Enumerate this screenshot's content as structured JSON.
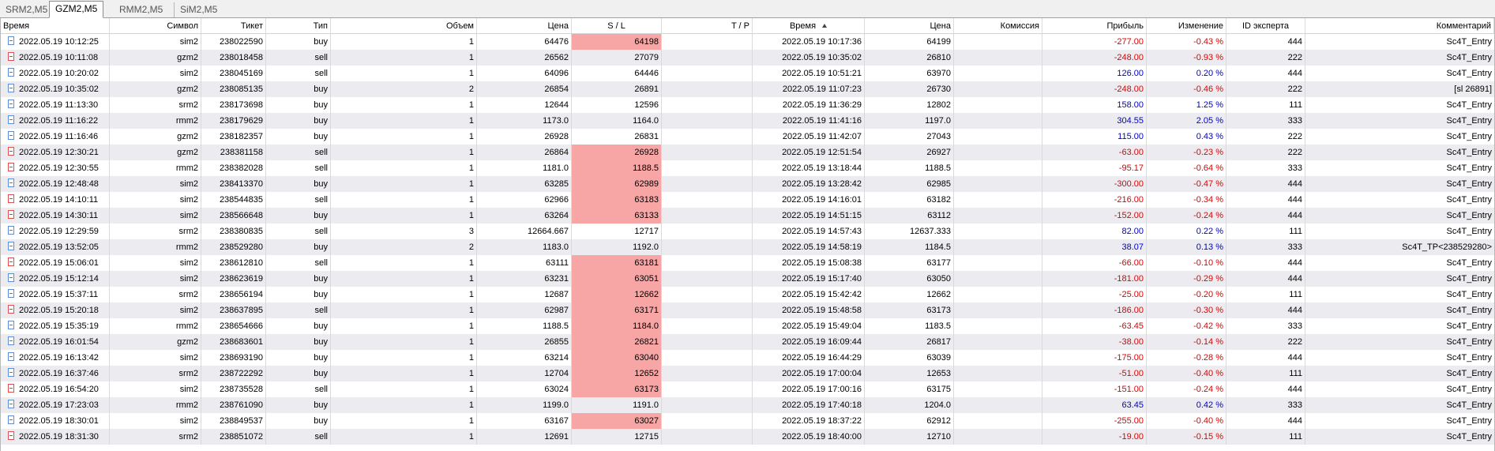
{
  "tabs": [
    "SRM2,M5",
    "GZM2,M5",
    "RMM2,M5",
    "SiM2,M5"
  ],
  "active_tab": 1,
  "headers": [
    "Время",
    "Символ",
    "Тикет",
    "Тип",
    "Объем",
    "Цена",
    "S / L",
    "T / P",
    "Время",
    "Цена",
    "Комиссия",
    "Прибыль",
    "Изменение",
    "ID эксперта",
    "Комментарий"
  ],
  "rows": [
    {
      "icon": "buy",
      "open": "2022.05.19 10:12:25",
      "sym": "sim2",
      "ticket": "238022590",
      "type": "buy",
      "vol": "1",
      "price": "64476",
      "sl": "64198",
      "sl_hl": true,
      "tp": "",
      "close": "2022.05.19 10:17:36",
      "cprice": "64199",
      "comm": "",
      "profit": "-277.00",
      "change": "-0.43 %",
      "id": "444",
      "comment": "Sc4T_Entry"
    },
    {
      "icon": "sell",
      "open": "2022.05.19 10:11:08",
      "sym": "gzm2",
      "ticket": "238018458",
      "type": "sell",
      "vol": "1",
      "price": "26562",
      "sl": "27079",
      "sl_hl": false,
      "tp": "",
      "close": "2022.05.19 10:35:02",
      "cprice": "26810",
      "comm": "",
      "profit": "-248.00",
      "change": "-0.93 %",
      "id": "222",
      "comment": "Sc4T_Entry"
    },
    {
      "icon": "buy",
      "open": "2022.05.19 10:20:02",
      "sym": "sim2",
      "ticket": "238045169",
      "type": "sell",
      "vol": "1",
      "price": "64096",
      "sl": "64446",
      "sl_hl": false,
      "tp": "",
      "close": "2022.05.19 10:51:21",
      "cprice": "63970",
      "comm": "",
      "profit": "126.00",
      "change": "0.20 %",
      "id": "444",
      "comment": "Sc4T_Entry"
    },
    {
      "icon": "buy",
      "open": "2022.05.19 10:35:02",
      "sym": "gzm2",
      "ticket": "238085135",
      "type": "buy",
      "vol": "2",
      "price": "26854",
      "sl": "26891",
      "sl_hl": false,
      "tp": "",
      "close": "2022.05.19 11:07:23",
      "cprice": "26730",
      "comm": "",
      "profit": "-248.00",
      "change": "-0.46 %",
      "id": "222",
      "comment": "[sl 26891]"
    },
    {
      "icon": "buy",
      "open": "2022.05.19 11:13:30",
      "sym": "srm2",
      "ticket": "238173698",
      "type": "buy",
      "vol": "1",
      "price": "12644",
      "sl": "12596",
      "sl_hl": false,
      "tp": "",
      "close": "2022.05.19 11:36:29",
      "cprice": "12802",
      "comm": "",
      "profit": "158.00",
      "change": "1.25 %",
      "id": "111",
      "comment": "Sc4T_Entry"
    },
    {
      "icon": "buy",
      "open": "2022.05.19 11:16:22",
      "sym": "rmm2",
      "ticket": "238179629",
      "type": "buy",
      "vol": "1",
      "price": "1173.0",
      "sl": "1164.0",
      "sl_hl": false,
      "tp": "",
      "close": "2022.05.19 11:41:16",
      "cprice": "1197.0",
      "comm": "",
      "profit": "304.55",
      "change": "2.05 %",
      "id": "333",
      "comment": "Sc4T_Entry"
    },
    {
      "icon": "buy",
      "open": "2022.05.19 11:16:46",
      "sym": "gzm2",
      "ticket": "238182357",
      "type": "buy",
      "vol": "1",
      "price": "26928",
      "sl": "26831",
      "sl_hl": false,
      "tp": "",
      "close": "2022.05.19 11:42:07",
      "cprice": "27043",
      "comm": "",
      "profit": "115.00",
      "change": "0.43 %",
      "id": "222",
      "comment": "Sc4T_Entry"
    },
    {
      "icon": "sell",
      "open": "2022.05.19 12:30:21",
      "sym": "gzm2",
      "ticket": "238381158",
      "type": "sell",
      "vol": "1",
      "price": "26864",
      "sl": "26928",
      "sl_hl": true,
      "tp": "",
      "close": "2022.05.19 12:51:54",
      "cprice": "26927",
      "comm": "",
      "profit": "-63.00",
      "change": "-0.23 %",
      "id": "222",
      "comment": "Sc4T_Entry"
    },
    {
      "icon": "sell",
      "open": "2022.05.19 12:30:55",
      "sym": "rmm2",
      "ticket": "238382028",
      "type": "sell",
      "vol": "1",
      "price": "1181.0",
      "sl": "1188.5",
      "sl_hl": true,
      "tp": "",
      "close": "2022.05.19 13:18:44",
      "cprice": "1188.5",
      "comm": "",
      "profit": "-95.17",
      "change": "-0.64 %",
      "id": "333",
      "comment": "Sc4T_Entry"
    },
    {
      "icon": "buy",
      "open": "2022.05.19 12:48:48",
      "sym": "sim2",
      "ticket": "238413370",
      "type": "buy",
      "vol": "1",
      "price": "63285",
      "sl": "62989",
      "sl_hl": true,
      "tp": "",
      "close": "2022.05.19 13:28:42",
      "cprice": "62985",
      "comm": "",
      "profit": "-300.00",
      "change": "-0.47 %",
      "id": "444",
      "comment": "Sc4T_Entry"
    },
    {
      "icon": "sell",
      "open": "2022.05.19 14:10:11",
      "sym": "sim2",
      "ticket": "238544835",
      "type": "sell",
      "vol": "1",
      "price": "62966",
      "sl": "63183",
      "sl_hl": true,
      "tp": "",
      "close": "2022.05.19 14:16:01",
      "cprice": "63182",
      "comm": "",
      "profit": "-216.00",
      "change": "-0.34 %",
      "id": "444",
      "comment": "Sc4T_Entry"
    },
    {
      "icon": "sell",
      "open": "2022.05.19 14:30:11",
      "sym": "sim2",
      "ticket": "238566648",
      "type": "buy",
      "vol": "1",
      "price": "63264",
      "sl": "63133",
      "sl_hl": true,
      "tp": "",
      "close": "2022.05.19 14:51:15",
      "cprice": "63112",
      "comm": "",
      "profit": "-152.00",
      "change": "-0.24 %",
      "id": "444",
      "comment": "Sc4T_Entry"
    },
    {
      "icon": "buy",
      "open": "2022.05.19 12:29:59",
      "sym": "srm2",
      "ticket": "238380835",
      "type": "sell",
      "vol": "3",
      "price": "12664.667",
      "sl": "12717",
      "sl_hl": false,
      "tp": "",
      "close": "2022.05.19 14:57:43",
      "cprice": "12637.333",
      "comm": "",
      "profit": "82.00",
      "change": "0.22 %",
      "id": "111",
      "comment": "Sc4T_Entry"
    },
    {
      "icon": "buy",
      "open": "2022.05.19 13:52:05",
      "sym": "rmm2",
      "ticket": "238529280",
      "type": "buy",
      "vol": "2",
      "price": "1183.0",
      "sl": "1192.0",
      "sl_hl": false,
      "tp": "",
      "close": "2022.05.19 14:58:19",
      "cprice": "1184.5",
      "comm": "",
      "profit": "38.07",
      "change": "0.13 %",
      "id": "333",
      "comment": "Sc4T_TP<238529280>"
    },
    {
      "icon": "sell",
      "open": "2022.05.19 15:06:01",
      "sym": "sim2",
      "ticket": "238612810",
      "type": "sell",
      "vol": "1",
      "price": "63111",
      "sl": "63181",
      "sl_hl": true,
      "tp": "",
      "close": "2022.05.19 15:08:38",
      "cprice": "63177",
      "comm": "",
      "profit": "-66.00",
      "change": "-0.10 %",
      "id": "444",
      "comment": "Sc4T_Entry"
    },
    {
      "icon": "buy",
      "open": "2022.05.19 15:12:14",
      "sym": "sim2",
      "ticket": "238623619",
      "type": "buy",
      "vol": "1",
      "price": "63231",
      "sl": "63051",
      "sl_hl": true,
      "tp": "",
      "close": "2022.05.19 15:17:40",
      "cprice": "63050",
      "comm": "",
      "profit": "-181.00",
      "change": "-0.29 %",
      "id": "444",
      "comment": "Sc4T_Entry"
    },
    {
      "icon": "buy",
      "open": "2022.05.19 15:37:11",
      "sym": "srm2",
      "ticket": "238656194",
      "type": "buy",
      "vol": "1",
      "price": "12687",
      "sl": "12662",
      "sl_hl": true,
      "tp": "",
      "close": "2022.05.19 15:42:42",
      "cprice": "12662",
      "comm": "",
      "profit": "-25.00",
      "change": "-0.20 %",
      "id": "111",
      "comment": "Sc4T_Entry"
    },
    {
      "icon": "sell",
      "open": "2022.05.19 15:20:18",
      "sym": "sim2",
      "ticket": "238637895",
      "type": "sell",
      "vol": "1",
      "price": "62987",
      "sl": "63171",
      "sl_hl": true,
      "tp": "",
      "close": "2022.05.19 15:48:58",
      "cprice": "63173",
      "comm": "",
      "profit": "-186.00",
      "change": "-0.30 %",
      "id": "444",
      "comment": "Sc4T_Entry"
    },
    {
      "icon": "buy",
      "open": "2022.05.19 15:35:19",
      "sym": "rmm2",
      "ticket": "238654666",
      "type": "buy",
      "vol": "1",
      "price": "1188.5",
      "sl": "1184.0",
      "sl_hl": true,
      "tp": "",
      "close": "2022.05.19 15:49:04",
      "cprice": "1183.5",
      "comm": "",
      "profit": "-63.45",
      "change": "-0.42 %",
      "id": "333",
      "comment": "Sc4T_Entry"
    },
    {
      "icon": "buy",
      "open": "2022.05.19 16:01:54",
      "sym": "gzm2",
      "ticket": "238683601",
      "type": "buy",
      "vol": "1",
      "price": "26855",
      "sl": "26821",
      "sl_hl": true,
      "tp": "",
      "close": "2022.05.19 16:09:44",
      "cprice": "26817",
      "comm": "",
      "profit": "-38.00",
      "change": "-0.14 %",
      "id": "222",
      "comment": "Sc4T_Entry"
    },
    {
      "icon": "buy",
      "open": "2022.05.19 16:13:42",
      "sym": "sim2",
      "ticket": "238693190",
      "type": "buy",
      "vol": "1",
      "price": "63214",
      "sl": "63040",
      "sl_hl": true,
      "tp": "",
      "close": "2022.05.19 16:44:29",
      "cprice": "63039",
      "comm": "",
      "profit": "-175.00",
      "change": "-0.28 %",
      "id": "444",
      "comment": "Sc4T_Entry"
    },
    {
      "icon": "buy",
      "open": "2022.05.19 16:37:46",
      "sym": "srm2",
      "ticket": "238722292",
      "type": "buy",
      "vol": "1",
      "price": "12704",
      "sl": "12652",
      "sl_hl": true,
      "tp": "",
      "close": "2022.05.19 17:00:04",
      "cprice": "12653",
      "comm": "",
      "profit": "-51.00",
      "change": "-0.40 %",
      "id": "111",
      "comment": "Sc4T_Entry"
    },
    {
      "icon": "sell",
      "open": "2022.05.19 16:54:20",
      "sym": "sim2",
      "ticket": "238735528",
      "type": "sell",
      "vol": "1",
      "price": "63024",
      "sl": "63173",
      "sl_hl": true,
      "tp": "",
      "close": "2022.05.19 17:00:16",
      "cprice": "63175",
      "comm": "",
      "profit": "-151.00",
      "change": "-0.24 %",
      "id": "444",
      "comment": "Sc4T_Entry"
    },
    {
      "icon": "buy",
      "open": "2022.05.19 17:23:03",
      "sym": "rmm2",
      "ticket": "238761090",
      "type": "buy",
      "vol": "1",
      "price": "1199.0",
      "sl": "1191.0",
      "sl_hl": false,
      "tp": "",
      "close": "2022.05.19 17:40:18",
      "cprice": "1204.0",
      "comm": "",
      "profit": "63.45",
      "change": "0.42 %",
      "id": "333",
      "comment": "Sc4T_Entry"
    },
    {
      "icon": "buy",
      "open": "2022.05.19 18:30:01",
      "sym": "sim2",
      "ticket": "238849537",
      "type": "buy",
      "vol": "1",
      "price": "63167",
      "sl": "63027",
      "sl_hl": true,
      "tp": "",
      "close": "2022.05.19 18:37:22",
      "cprice": "62912",
      "comm": "",
      "profit": "-255.00",
      "change": "-0.40 %",
      "id": "444",
      "comment": "Sc4T_Entry"
    },
    {
      "icon": "sell",
      "open": "2022.05.19 18:31:30",
      "sym": "srm2",
      "ticket": "238851072",
      "type": "sell",
      "vol": "1",
      "price": "12691",
      "sl": "12715",
      "sl_hl": false,
      "tp": "",
      "close": "2022.05.19 18:40:00",
      "cprice": "12710",
      "comm": "",
      "profit": "-19.00",
      "change": "-0.15 %",
      "id": "111",
      "comment": "Sc4T_Entry"
    }
  ],
  "colors": {
    "sl_highlight": "#f7a5a5",
    "loss": "#e00000",
    "gain": "#0000cc",
    "row_alt": "#ececf0"
  }
}
